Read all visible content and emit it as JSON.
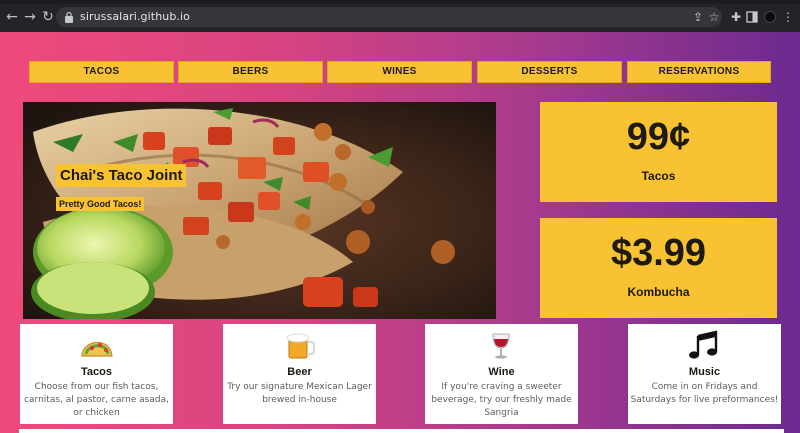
{
  "browser": {
    "url": "sirussalari.github.io",
    "back_icon": "arrow-left-icon",
    "forward_icon": "arrow-right-icon",
    "reload_icon": "reload-icon"
  },
  "nav": {
    "items": [
      "TACOS",
      "BEERS",
      "WINES",
      "DESSERTS",
      "RESERVATIONS"
    ]
  },
  "hero": {
    "title": "Chai's Taco Joint",
    "subtitle": "Pretty Good Tacos!"
  },
  "prices": [
    {
      "amount": "99¢",
      "label": "Tacos"
    },
    {
      "amount": "$3.99",
      "label": "Kombucha"
    }
  ],
  "cards": [
    {
      "icon": "taco-icon",
      "title": "Tacos",
      "body": "Choose from our fish tacos, carnitas, al pastor, carne asada, or chicken"
    },
    {
      "icon": "beer-mug-icon",
      "title": "Beer",
      "body": "Try our signature Mexican Lager brewed in-house"
    },
    {
      "icon": "wine-glass-icon",
      "title": "Wine",
      "body": "If you're craving a sweeter beverage, try our freshly made Sangria"
    },
    {
      "icon": "music-notes-icon",
      "title": "Music",
      "body": "Come in on Fridays and Saturdays for live preformances!"
    }
  ],
  "colors": {
    "accent_yellow": "#f8c233",
    "gradient_start": "#ef4a7b",
    "gradient_end": "#6b2a8f"
  }
}
